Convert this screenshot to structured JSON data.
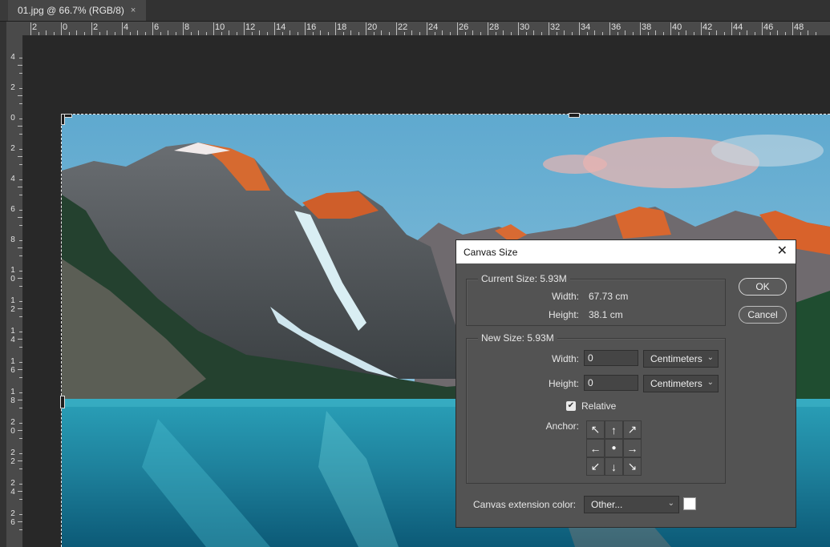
{
  "document_tab": {
    "title": "01.jpg @ 66.7% (RGB/8)",
    "close_glyph": "×"
  },
  "rulers": {
    "horizontal": [
      "2",
      "0",
      "2",
      "4",
      "6",
      "8",
      "10",
      "12",
      "14",
      "16",
      "18",
      "20",
      "22",
      "24",
      "26",
      "28",
      "30",
      "32",
      "34",
      "36",
      "38",
      "40",
      "42",
      "44",
      "46",
      "48"
    ],
    "vertical": [
      "4",
      "2",
      "0",
      "2",
      "4",
      "6",
      "8",
      "1 0",
      "1 2",
      "1 4",
      "1 6",
      "1 8",
      "2 0",
      "2 2",
      "2 4",
      "2 6"
    ]
  },
  "dialog": {
    "title": "Canvas Size",
    "close_glyph": "✕",
    "current_size": {
      "label": "Current Size: 5.93M",
      "width_label": "Width:",
      "width_value": "67.73 cm",
      "height_label": "Height:",
      "height_value": "38.1 cm"
    },
    "new_size": {
      "label": "New Size: 5.93M",
      "width_label": "Width:",
      "width_value": "0",
      "width_unit": "Centimeters",
      "height_label": "Height:",
      "height_value": "0",
      "height_unit": "Centimeters",
      "relative_label": "Relative",
      "relative_checked": true,
      "anchor_label": "Anchor:",
      "anchor_glyphs": [
        "↖",
        "↑",
        "↗",
        "←",
        "●",
        "→",
        "↙",
        "↓",
        "↘"
      ]
    },
    "extension_color": {
      "label": "Canvas extension color:",
      "value": "Other...",
      "swatch_color": "#ffffff"
    },
    "ok_label": "OK",
    "cancel_label": "Cancel"
  }
}
